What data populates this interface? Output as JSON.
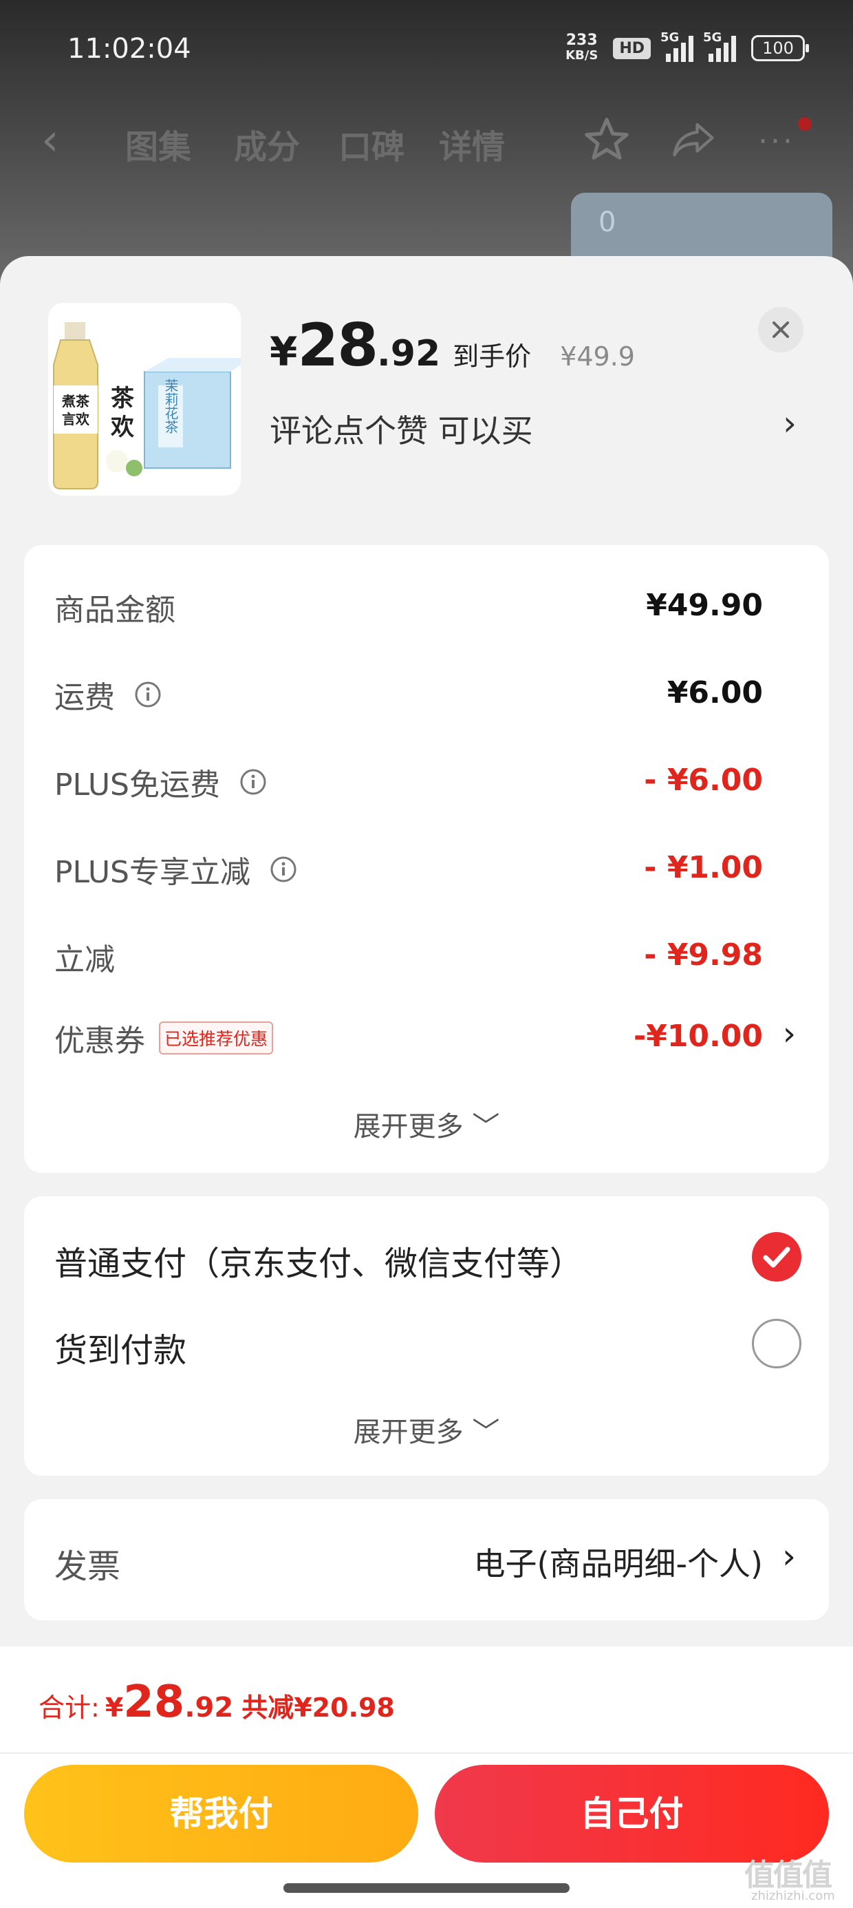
{
  "status_bar": {
    "time": "11:02:04",
    "net_speed_value": "233",
    "net_speed_unit": "KB/S",
    "hd": "HD",
    "sim1": "5G",
    "sim2": "5G",
    "battery": "100"
  },
  "nav": {
    "tabs": [
      "图集",
      "成分",
      "口碑",
      "详情"
    ],
    "active_tab": "图集"
  },
  "product": {
    "price_symbol": "¥",
    "price_integer": "28",
    "price_decimal": ".92",
    "price_tag": "到手价",
    "original_price": "¥49.9",
    "promo_text": "评论点个赞  可以买",
    "promo_arrow": "›",
    "brand_text": "煮茶言欢",
    "box_text": "茉莉花茶"
  },
  "price_breakdown": {
    "rows": [
      {
        "label": "商品金额",
        "value": "¥49.90",
        "info": false,
        "red": false
      },
      {
        "label": "运费",
        "value": "¥6.00",
        "info": true,
        "red": false
      },
      {
        "label": "PLUS免运费",
        "value": "- ¥6.00",
        "info": true,
        "red": true
      },
      {
        "label": "PLUS专享立减",
        "value": "- ¥1.00",
        "info": true,
        "red": true
      },
      {
        "label": "立减",
        "value": "- ¥9.98",
        "info": false,
        "red": true
      }
    ],
    "coupon": {
      "label": "优惠券",
      "badge": "已选推荐优惠",
      "value": "-¥10.00",
      "arrow": "›"
    },
    "expand": "展开更多 ﹀"
  },
  "payment": {
    "options": [
      {
        "label": "普通支付（京东支付、微信支付等）",
        "selected": true
      },
      {
        "label": "货到付款",
        "selected": false
      }
    ],
    "expand": "展开更多 ﹀"
  },
  "invoice": {
    "label": "发票",
    "value": "电子(商品明细-个人)",
    "arrow": "›"
  },
  "footer": {
    "total_label": "合计:",
    "total_symbol": "¥",
    "total_integer": "28",
    "total_decimal": ".92",
    "total_saved": "共减¥20.98",
    "help_pay_label": "帮我付",
    "self_pay_label": "自己付",
    "watermark": "值值值",
    "watermark_sub": "zhizhizhi.com"
  },
  "colors": {
    "accent_red": "#e0251d",
    "yellow_button": "#ffb815",
    "red_button": "#f0394c"
  }
}
